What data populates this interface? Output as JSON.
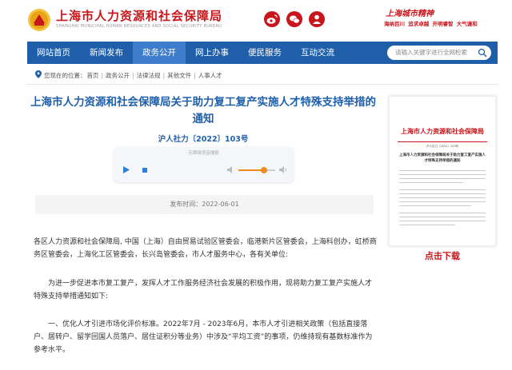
{
  "header": {
    "site_title": "上海市人力资源和社会保障局",
    "site_subtitle": "SHANGHAI MUNICIPAL HUMAN RESOURCES AND SOCIAL SECURITY BUREAU",
    "social_icons": [
      "weibo-icon",
      "wechat-icon",
      "person-icon"
    ],
    "spirit_title": "上海城市精神",
    "spirit_line": "海纳百川 追求卓越 开明睿智 大气谦和"
  },
  "nav": {
    "items": [
      "网站首页",
      "新闻发布",
      "政务公开",
      "网上办事",
      "便民服务",
      "互动交流"
    ],
    "active_index": 2,
    "search_placeholder": "请输入关键字进行全网检索"
  },
  "breadcrumb": {
    "label": "您现在的位置：",
    "items": [
      "首页",
      "政务公开",
      "法律法规",
      "其他文件",
      "人事人才"
    ]
  },
  "article": {
    "title": "上海市人力资源和社会保障局关于助力复工复产实施人才特殊支持举措的通知",
    "doc_number": "沪人社力〔2022〕103号",
    "player_caption": "无障碍语音播报",
    "volume_level": 0.7,
    "publish_date": "发布时间：2022-06-01",
    "paragraphs": [
      "各区人力资源和社会保障局, 中国（上海）自由贸易试验区管委会，临港新片区管委会，上海科创办，虹桥商务区管委会，上海化工区管委会，长兴岛管委会，市人才服务中心，各有关单位:",
      "为进一步促进本市复工复产，发挥人才工作服务经济社会发展的积极作用，现将助力复工复产实施人才特殊支持举措通知如下:",
      "一、优化人才引进市场化评价标准。2022年7月 - 2023年6月，本市人才引进相关政策（包括直接落户、居转户、留学回国人员落户、居住证积分等业务）中涉及“平均工资”的事项，仍维持现有基数标准作为参考水平。"
    ]
  },
  "preview": {
    "org": "上海市人力资源和社会保障局",
    "doc_number": "沪人社力〔2022〕103号",
    "title": "上海市人力资源和社会保障局关于助力复工复产实施人才特殊支持举措的通知",
    "download_label": "点击下载"
  },
  "colors": {
    "brand_red": "#c8161d",
    "nav_blue": "#1f5faa",
    "nav_active": "#3d7dcc",
    "accent_orange": "#f08b1e"
  }
}
